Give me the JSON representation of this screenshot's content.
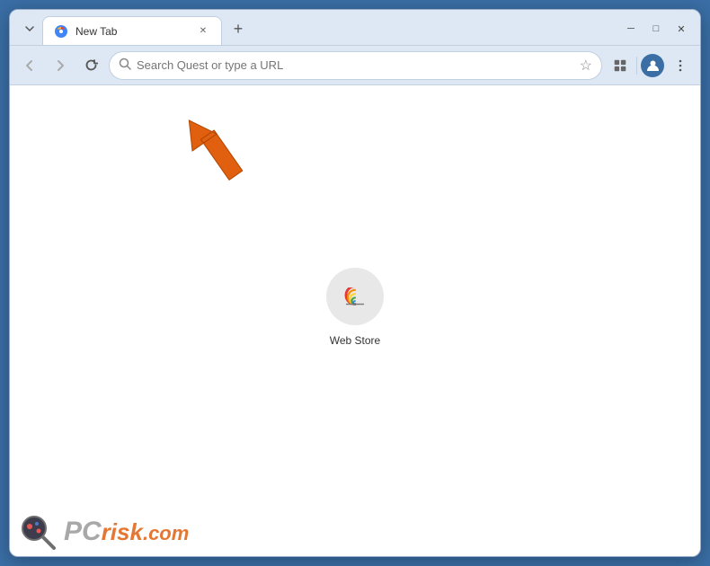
{
  "window": {
    "title": "New Tab",
    "controls": {
      "minimize": "─",
      "maximize": "□",
      "close": "✕"
    }
  },
  "tab": {
    "label": "New Tab",
    "close_label": "✕"
  },
  "toolbar": {
    "back_label": "←",
    "forward_label": "→",
    "reload_label": "↻",
    "address_placeholder": "Search Quest or type a URL",
    "bookmark_label": "☆",
    "extensions_label": "🧩",
    "menu_label": "⋮"
  },
  "shortcuts": [
    {
      "id": "web-store",
      "label": "Web Store"
    }
  ],
  "watermark": {
    "site": "PCrisk.com",
    "pc": "PC",
    "risk": "risk",
    "dot_com": ".com"
  },
  "arrow": {
    "color": "#e06010"
  }
}
